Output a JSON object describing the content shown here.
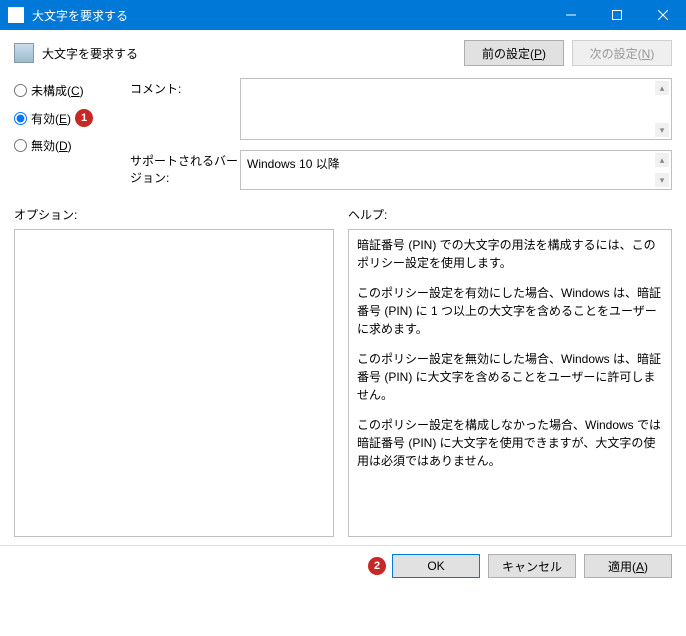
{
  "window": {
    "title": "大文字を要求する"
  },
  "header": {
    "title": "大文字を要求する",
    "prev_btn": "前の設定(P)",
    "next_btn": "次の設定(N)"
  },
  "radios": {
    "not_configured": "未構成(C)",
    "enabled": "有効(E)",
    "disabled": "無効(D)",
    "marker1": "1"
  },
  "fields": {
    "comment_label": "コメント:",
    "support_label": "サポートされるバージョン:",
    "support_value": "Windows 10 以降"
  },
  "lower": {
    "options_label": "オプション:",
    "help_label": "ヘルプ:",
    "help_p1": "暗証番号 (PIN) での大文字の用法を構成するには、このポリシー設定を使用します。",
    "help_p2": "このポリシー設定を有効にした場合、Windows は、暗証番号 (PIN) に 1 つ以上の大文字を含めることをユーザーに求めます。",
    "help_p3": "このポリシー設定を無効にした場合、Windows は、暗証番号 (PIN) に大文字を含めることをユーザーに許可しません。",
    "help_p4": "このポリシー設定を構成しなかった場合、Windows では暗証番号 (PIN) に大文字を使用できますが、大文字の使用は必須ではありません。"
  },
  "footer": {
    "marker2": "2",
    "ok": "OK",
    "cancel": "キャンセル",
    "apply": "適用(A)"
  }
}
